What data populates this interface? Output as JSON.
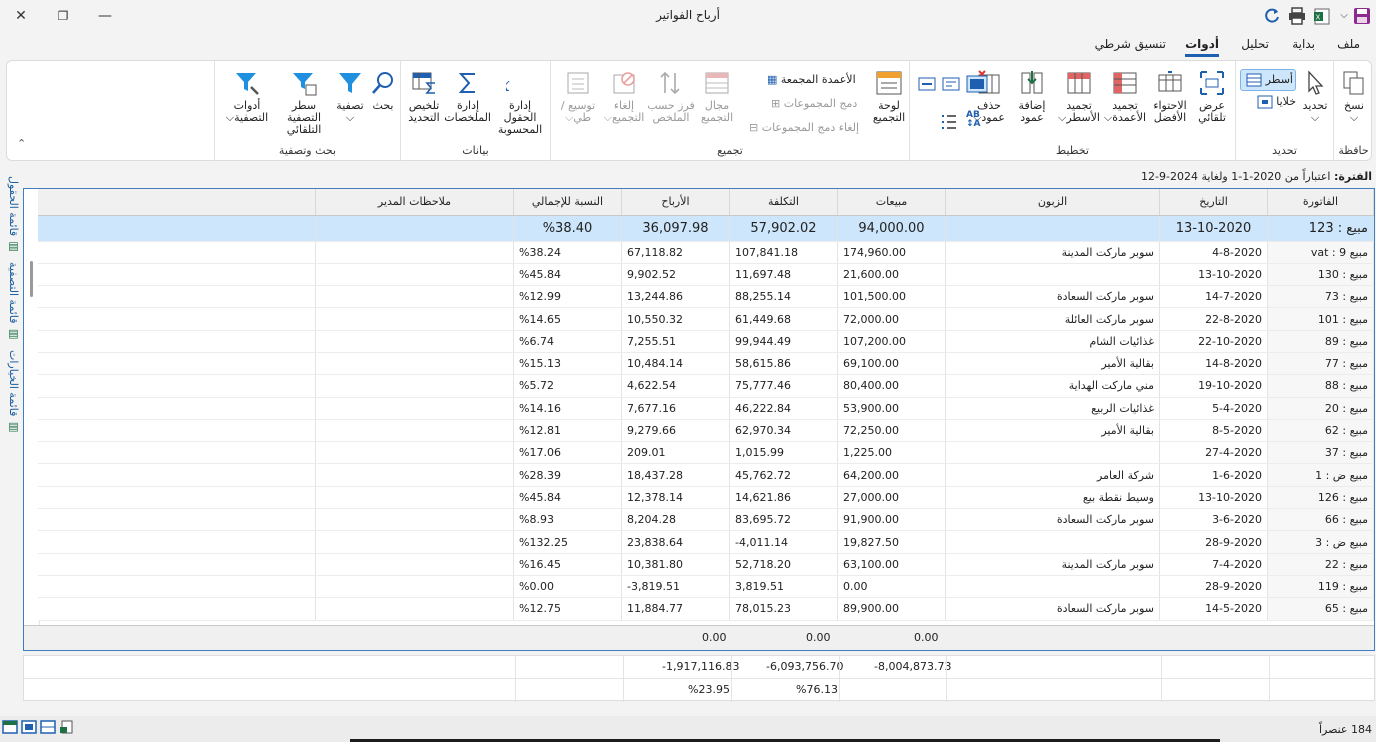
{
  "window": {
    "title": "أرباح الفواتير"
  },
  "menu": {
    "tabs": [
      "ملف",
      "بداية",
      "تحليل",
      "أدوات",
      "تنسيق شرطي"
    ],
    "active": "أدوات"
  },
  "ribbon": {
    "groups": {
      "clipboard": "حافظة",
      "select": "تحديد",
      "layout": "تخطيط",
      "grouping": "تجميع",
      "data": "بيانات",
      "search_filter": "بحث وتصفية"
    },
    "buttons": {
      "copy": "نسخ",
      "select": "تحديد",
      "rows": "أسطر",
      "cells": "خلايا",
      "auto_width": "عرض تلقائي",
      "best_fit": "الاحتواء الأفضل",
      "freeze_cols": "تجميد الأعمدة",
      "freeze_rows": "تجميد الأسطر",
      "add_col": "إضافة عمود",
      "del_col": "حذف عمود",
      "group_panel": "لوحة التجميع",
      "grouped_cols": "الأعمدة المجمعة",
      "merge_groups": "دمج المجموعات",
      "unmerge_groups": "إلغاء دمج المجموعات",
      "group_field": "مجال التجميع",
      "sort_summary": "فرز حسب الملخص",
      "ungroup": "إلغاء التجميع",
      "expand": "توسيع / طي",
      "calc_fields": "إدارة الحقول المحسوبة",
      "summaries": "إدارة الملخصات",
      "sel_summary": "تلخيص التحديد",
      "search": "بحث",
      "filter": "تصفية",
      "auto_filter_row": "سطر التصفية التلقائي",
      "filter_tools": "أدوات التصفية"
    }
  },
  "period_label": "الفترة:",
  "period_text": "اعتباراً من 2020-1-1 ولغاية 2024-9-12",
  "side_tabs": [
    "قائمة الحقول",
    "قائمة التصفية",
    "قائمة الخيارات"
  ],
  "columns": [
    "الفاتورة",
    "التاريخ",
    "الزبون",
    "مبيعات",
    "التكلفة",
    "الأرباح",
    "النسبة للإجمالي",
    "ملاحظات المدير"
  ],
  "selected_row": [
    "مبيع : 123",
    "13-10-2020",
    "",
    "94,000.00",
    "57,902.02",
    "36,097.98",
    "%38.40",
    ""
  ],
  "rows": [
    [
      "مبيع vat : 9",
      "4-8-2020",
      "سوبر ماركت المدينة",
      "174,960.00",
      "107,841.18",
      "67,118.82",
      "%38.24"
    ],
    [
      "مبيع : 130",
      "13-10-2020",
      "",
      "21,600.00",
      "11,697.48",
      "9,902.52",
      "%45.84"
    ],
    [
      "مبيع : 73",
      "14-7-2020",
      "سوبر ماركت السعادة",
      "101,500.00",
      "88,255.14",
      "13,244.86",
      "%12.99"
    ],
    [
      "مبيع : 101",
      "22-8-2020",
      "سوبر ماركت العائلة",
      "72,000.00",
      "61,449.68",
      "10,550.32",
      "%14.65"
    ],
    [
      "مبيع : 89",
      "22-10-2020",
      "غذائيات الشام",
      "107,200.00",
      "99,944.49",
      "7,255.51",
      "%6.74"
    ],
    [
      "مبيع : 77",
      "14-8-2020",
      "بقالية الأمير",
      "69,100.00",
      "58,615.86",
      "10,484.14",
      "%15.13"
    ],
    [
      "مبيع : 88",
      "19-10-2020",
      "مني ماركت الهداية",
      "80,400.00",
      "75,777.46",
      "4,622.54",
      "%5.72"
    ],
    [
      "مبيع : 20",
      "5-4-2020",
      "غذائيات الربيع",
      "53,900.00",
      "46,222.84",
      "7,677.16",
      "%14.16"
    ],
    [
      "مبيع : 62",
      "8-5-2020",
      "بقالية الأمير",
      "72,250.00",
      "62,970.34",
      "9,279.66",
      "%12.81"
    ],
    [
      "مبيع : 37",
      "27-4-2020",
      "",
      "1,225.00",
      "1,015.99",
      "209.01",
      "%17.06"
    ],
    [
      "مبيع ض : 1",
      "1-6-2020",
      "شركة العامر",
      "64,200.00",
      "45,762.72",
      "18,437.28",
      "%28.39"
    ],
    [
      "مبيع : 126",
      "13-10-2020",
      "وسيط نقطة بيع",
      "27,000.00",
      "14,621.86",
      "12,378.14",
      "%45.84"
    ],
    [
      "مبيع : 66",
      "3-6-2020",
      "سوبر ماركت السعادة",
      "91,900.00",
      "83,695.72",
      "8,204.28",
      "%8.93"
    ],
    [
      "مبيع ض : 3",
      "28-9-2020",
      "",
      "19,827.50",
      "-4,011.14",
      "23,838.64",
      "%132.25"
    ],
    [
      "مبيع : 22",
      "7-4-2020",
      "سوبر ماركت المدينة",
      "63,100.00",
      "52,718.20",
      "10,381.80",
      "%16.45"
    ],
    [
      "مبيع : 119",
      "28-9-2020",
      "",
      "0.00",
      "3,819.51",
      "-3,819.51",
      "%0.00"
    ],
    [
      "مبيع : 65",
      "14-5-2020",
      "سوبر ماركت السعادة",
      "89,900.00",
      "78,015.23",
      "11,884.77",
      "%12.75"
    ]
  ],
  "group_footer": {
    "sales": "0.00",
    "cost": "0.00",
    "profit": "0.00"
  },
  "totals": {
    "sales": "-8,004,873.73",
    "cost": "-6,093,756.70",
    "profit": "-1,917,116.83",
    "cost_pct": "%76.13",
    "profit_pct": "%23.95"
  },
  "status": {
    "count": "184 عنصراً"
  },
  "colors": {
    "accent": "#1f5fb0",
    "selected_row": "#cde6fb",
    "grid_border": "#3f7fc0"
  }
}
